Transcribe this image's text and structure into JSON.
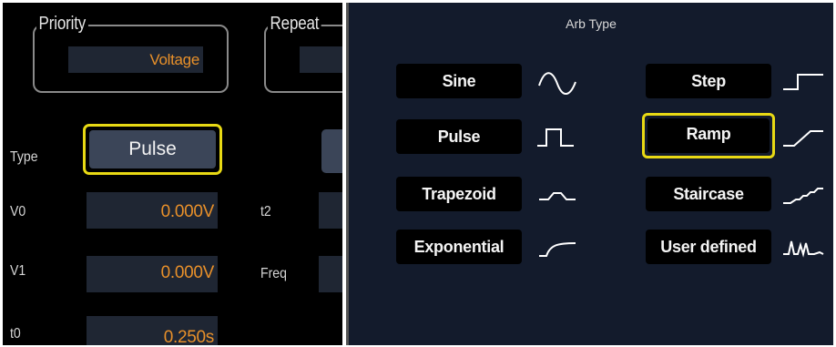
{
  "left_panel": {
    "priority": {
      "title": "Priority",
      "value": "Voltage"
    },
    "repeat": {
      "title": "Repeat"
    },
    "type": {
      "label": "Type",
      "value": "Pulse"
    },
    "rows": [
      {
        "label": "V0",
        "value": "0.000V"
      },
      {
        "label": "V1",
        "value": "0.000V"
      },
      {
        "label": "t0",
        "value": "0.250s"
      }
    ],
    "right_labels": {
      "t2": "t2",
      "freq": "Freq"
    }
  },
  "right_panel": {
    "title": "Arb Type",
    "buttons": [
      {
        "label": "Sine",
        "icon": "sine-wave-icon"
      },
      {
        "label": "Step",
        "icon": "step-wave-icon"
      },
      {
        "label": "Pulse",
        "icon": "pulse-wave-icon"
      },
      {
        "label": "Ramp",
        "icon": "ramp-wave-icon",
        "selected": true
      },
      {
        "label": "Trapezoid",
        "icon": "trapezoid-wave-icon"
      },
      {
        "label": "Staircase",
        "icon": "staircase-wave-icon"
      },
      {
        "label": "Exponential",
        "icon": "exponential-wave-icon"
      },
      {
        "label": "User defined",
        "icon": "user-defined-wave-icon"
      }
    ]
  },
  "colors": {
    "accent_yellow": "#e8d914",
    "value_orange": "#e8902a",
    "field_bg": "#1f2633",
    "panel_bg": "#131b2c"
  }
}
